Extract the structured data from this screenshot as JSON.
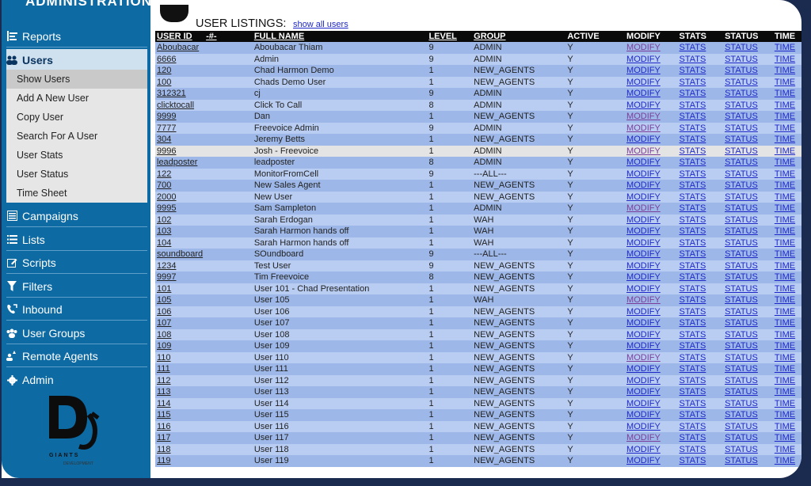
{
  "sidebar": {
    "top_title": "ADMINISTRATION",
    "items": [
      {
        "label": "Reports",
        "icon": "bar-chart-icon"
      },
      {
        "label": "Users",
        "icon": "users-icon"
      },
      {
        "label": "Campaigns",
        "icon": "campaign-icon"
      },
      {
        "label": "Lists",
        "icon": "list-icon"
      },
      {
        "label": "Scripts",
        "icon": "edit-icon"
      },
      {
        "label": "Filters",
        "icon": "filter-icon"
      },
      {
        "label": "Inbound",
        "icon": "phone-icon"
      },
      {
        "label": "User Groups",
        "icon": "group-icon"
      },
      {
        "label": "Remote Agents",
        "icon": "remote-agent-icon"
      },
      {
        "label": "Admin",
        "icon": "gear-icon"
      }
    ],
    "submenu": [
      "Show Users",
      "Add A New User",
      "Copy User",
      "Search For A User",
      "User Stats",
      "User Status",
      "Time Sheet"
    ],
    "logo_text": "GIANTS",
    "logo_sub": "DEVELOPMENT"
  },
  "main": {
    "heading": "USER LISTINGS:",
    "show_all": "show all users",
    "columns": [
      "USER ID",
      "-#-",
      "FULL NAME",
      "LEVEL",
      "GROUP",
      "ACTIVE",
      "MODIFY",
      "STATS",
      "STATUS",
      "TIME"
    ],
    "link_labels": {
      "modify": "MODIFY",
      "stats": "STATS",
      "status": "STATUS",
      "time": "TIME"
    },
    "rows": [
      [
        "Aboubacar",
        "Aboubacar Thiam",
        "9",
        "ADMIN",
        "Y"
      ],
      [
        "6666",
        "Admin",
        "9",
        "ADMIN",
        "Y"
      ],
      [
        "120",
        "Chad Harmon Demo",
        "1",
        "NEW_AGENTS",
        "Y"
      ],
      [
        "100",
        "Chads Demo User",
        "1",
        "NEW_AGENTS",
        "Y"
      ],
      [
        "312321",
        "cj",
        "9",
        "ADMIN",
        "Y"
      ],
      [
        "clicktocall",
        "Click To Call",
        "8",
        "ADMIN",
        "Y"
      ],
      [
        "9999",
        "Dan",
        "1",
        "NEW_AGENTS",
        "Y"
      ],
      [
        "7777",
        "Freevoice Admin",
        "9",
        "ADMIN",
        "Y"
      ],
      [
        "304",
        "Jeremy Betts",
        "1",
        "NEW_AGENTS",
        "Y"
      ],
      [
        "9996",
        "Josh - Freevoice",
        "1",
        "ADMIN",
        "Y"
      ],
      [
        "leadposter",
        "leadposter",
        "8",
        "ADMIN",
        "Y"
      ],
      [
        "122",
        "MonitorFromCell",
        "9",
        "---ALL---",
        "Y"
      ],
      [
        "700",
        "New Sales Agent",
        "1",
        "NEW_AGENTS",
        "Y"
      ],
      [
        "2000",
        "New User",
        "1",
        "NEW_AGENTS",
        "Y"
      ],
      [
        "9995",
        "Sam Sampleton",
        "1",
        "ADMIN",
        "Y"
      ],
      [
        "102",
        "Sarah Erdogan",
        "1",
        "WAH",
        "Y"
      ],
      [
        "103",
        "Sarah Harmon hands off",
        "1",
        "WAH",
        "Y"
      ],
      [
        "104",
        "Sarah Harmon hands off",
        "1",
        "WAH",
        "Y"
      ],
      [
        "soundboard",
        "SOundboard",
        "9",
        "---ALL---",
        "Y"
      ],
      [
        "1234",
        "Test User",
        "9",
        "NEW_AGENTS",
        "Y"
      ],
      [
        "9997",
        "Tim Freevoice",
        "8",
        "NEW_AGENTS",
        "Y"
      ],
      [
        "101",
        "User 101 - Chad Presentation",
        "1",
        "NEW_AGENTS",
        "Y"
      ],
      [
        "105",
        "User 105",
        "1",
        "WAH",
        "Y"
      ],
      [
        "106",
        "User 106",
        "1",
        "NEW_AGENTS",
        "Y"
      ],
      [
        "107",
        "User 107",
        "1",
        "NEW_AGENTS",
        "Y"
      ],
      [
        "108",
        "User 108",
        "1",
        "NEW_AGENTS",
        "Y"
      ],
      [
        "109",
        "User 109",
        "1",
        "NEW_AGENTS",
        "Y"
      ],
      [
        "110",
        "User 110",
        "1",
        "NEW_AGENTS",
        "Y"
      ],
      [
        "111",
        "User 111",
        "1",
        "NEW_AGENTS",
        "Y"
      ],
      [
        "112",
        "User 112",
        "1",
        "NEW_AGENTS",
        "Y"
      ],
      [
        "113",
        "User 113",
        "1",
        "NEW_AGENTS",
        "Y"
      ],
      [
        "114",
        "User 114",
        "1",
        "NEW_AGENTS",
        "Y"
      ],
      [
        "115",
        "User 115",
        "1",
        "NEW_AGENTS",
        "Y"
      ],
      [
        "116",
        "User 116",
        "1",
        "NEW_AGENTS",
        "Y"
      ],
      [
        "117",
        "User 117",
        "1",
        "NEW_AGENTS",
        "Y"
      ],
      [
        "118",
        "User 118",
        "1",
        "NEW_AGENTS",
        "Y"
      ],
      [
        "119",
        "User 119",
        "1",
        "NEW_AGENTS",
        "Y"
      ]
    ],
    "highlight_row": 9,
    "visited_modify_rows": [
      0,
      6,
      7,
      9,
      14,
      22,
      27,
      34
    ],
    "colors": {
      "header_bg": "#0a0a0a",
      "row_a": "#9db8e8",
      "row_b": "#b9cdf3",
      "sidebar": "#0d6aa3",
      "link": "#1e28c8"
    }
  }
}
